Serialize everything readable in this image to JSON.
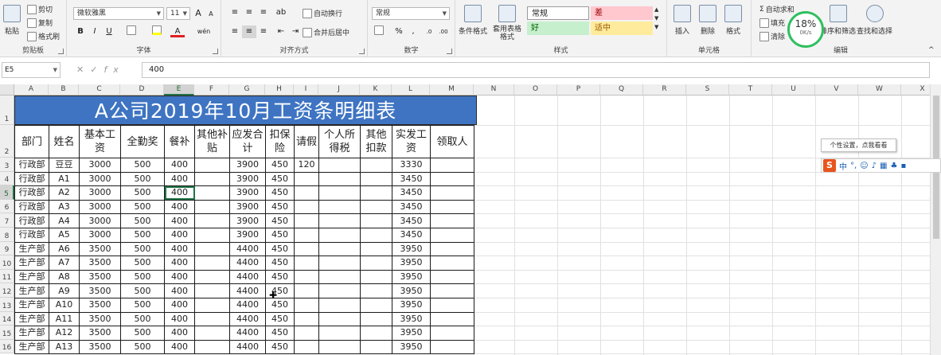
{
  "ribbon": {
    "clipboard": {
      "label": "剪贴板",
      "paste": "粘贴",
      "cut": "剪切",
      "copy": "复制",
      "format_painter": "格式刷"
    },
    "font": {
      "label": "字体",
      "name": "微软雅黑",
      "size": "11",
      "bold": "B",
      "italic": "I",
      "underline": "U",
      "grow": "A",
      "shrink": "A",
      "font_color": "A",
      "phonetic": "wén"
    },
    "alignment": {
      "label": "对齐方式",
      "wrap": "自动换行",
      "merge": "合并后居中"
    },
    "number": {
      "label": "数字",
      "format": "常规",
      "percent": "%",
      "comma": ","
    },
    "styles": {
      "label": "样式",
      "conditional": "条件格式",
      "table": "套用表格格式",
      "normal": "常规",
      "bad": "差",
      "good": "好",
      "neutral": "适中"
    },
    "cells": {
      "label": "单元格",
      "insert": "插入",
      "delete": "删除",
      "format": "格式"
    },
    "editing": {
      "label": "编辑",
      "autosum": "自动求和",
      "fill": "填充",
      "clear": "清除",
      "sort": "排序和筛选",
      "find": "查找和选择"
    }
  },
  "formula_bar": {
    "name_box": "E5",
    "value": "400"
  },
  "columns": [
    "A",
    "B",
    "C",
    "D",
    "E",
    "F",
    "G",
    "H",
    "I",
    "J",
    "K",
    "L",
    "M",
    "N",
    "O",
    "P",
    "Q",
    "R",
    "S",
    "T",
    "U",
    "V",
    "W",
    "X"
  ],
  "rows": [
    "1",
    "2",
    "3",
    "4",
    "5",
    "6",
    "7",
    "8",
    "9",
    "10",
    "11",
    "12",
    "13",
    "14",
    "15",
    "16"
  ],
  "sheet": {
    "title": "A公司2019年10月工资条明细表",
    "headers": [
      "部门",
      "姓名",
      "基本工资",
      "全勤奖",
      "餐补",
      "其他补贴",
      "应发合计",
      "扣保险",
      "请假",
      "个人所得税",
      "其他扣款",
      "实发工资",
      "领取人"
    ],
    "rows": [
      [
        "行政部",
        "豆豆",
        "3000",
        "500",
        "400",
        "",
        "3900",
        "450",
        "120",
        "",
        "",
        "3330",
        ""
      ],
      [
        "行政部",
        "A1",
        "3000",
        "500",
        "400",
        "",
        "3900",
        "450",
        "",
        "",
        "",
        "3450",
        ""
      ],
      [
        "行政部",
        "A2",
        "3000",
        "500",
        "400",
        "",
        "3900",
        "450",
        "",
        "",
        "",
        "3450",
        ""
      ],
      [
        "行政部",
        "A3",
        "3000",
        "500",
        "400",
        "",
        "3900",
        "450",
        "",
        "",
        "",
        "3450",
        ""
      ],
      [
        "行政部",
        "A4",
        "3000",
        "500",
        "400",
        "",
        "3900",
        "450",
        "",
        "",
        "",
        "3450",
        ""
      ],
      [
        "行政部",
        "A5",
        "3000",
        "500",
        "400",
        "",
        "3900",
        "450",
        "",
        "",
        "",
        "3450",
        ""
      ],
      [
        "生产部",
        "A6",
        "3500",
        "500",
        "400",
        "",
        "4400",
        "450",
        "",
        "",
        "",
        "3950",
        ""
      ],
      [
        "生产部",
        "A7",
        "3500",
        "500",
        "400",
        "",
        "4400",
        "450",
        "",
        "",
        "",
        "3950",
        ""
      ],
      [
        "生产部",
        "A8",
        "3500",
        "500",
        "400",
        "",
        "4400",
        "450",
        "",
        "",
        "",
        "3950",
        ""
      ],
      [
        "生产部",
        "A9",
        "3500",
        "500",
        "400",
        "",
        "4400",
        "450",
        "",
        "",
        "",
        "3950",
        ""
      ],
      [
        "生产部",
        "A10",
        "3500",
        "500",
        "400",
        "",
        "4400",
        "450",
        "",
        "",
        "",
        "3950",
        ""
      ],
      [
        "生产部",
        "A11",
        "3500",
        "500",
        "400",
        "",
        "4400",
        "450",
        "",
        "",
        "",
        "3950",
        ""
      ],
      [
        "生产部",
        "A12",
        "3500",
        "500",
        "400",
        "",
        "4400",
        "450",
        "",
        "",
        "",
        "3950",
        ""
      ],
      [
        "生产部",
        "A13",
        "3500",
        "500",
        "400",
        "",
        "4400",
        "450",
        "",
        "",
        "",
        "3950",
        ""
      ]
    ]
  },
  "tooltip": "个性设置，点我看看",
  "ime": {
    "logo": "S",
    "mode": "中"
  },
  "speed": {
    "percent": "18%",
    "rate": "0K/s"
  },
  "colors": {
    "title_bg": "#3e74c2",
    "select": "#217346"
  }
}
